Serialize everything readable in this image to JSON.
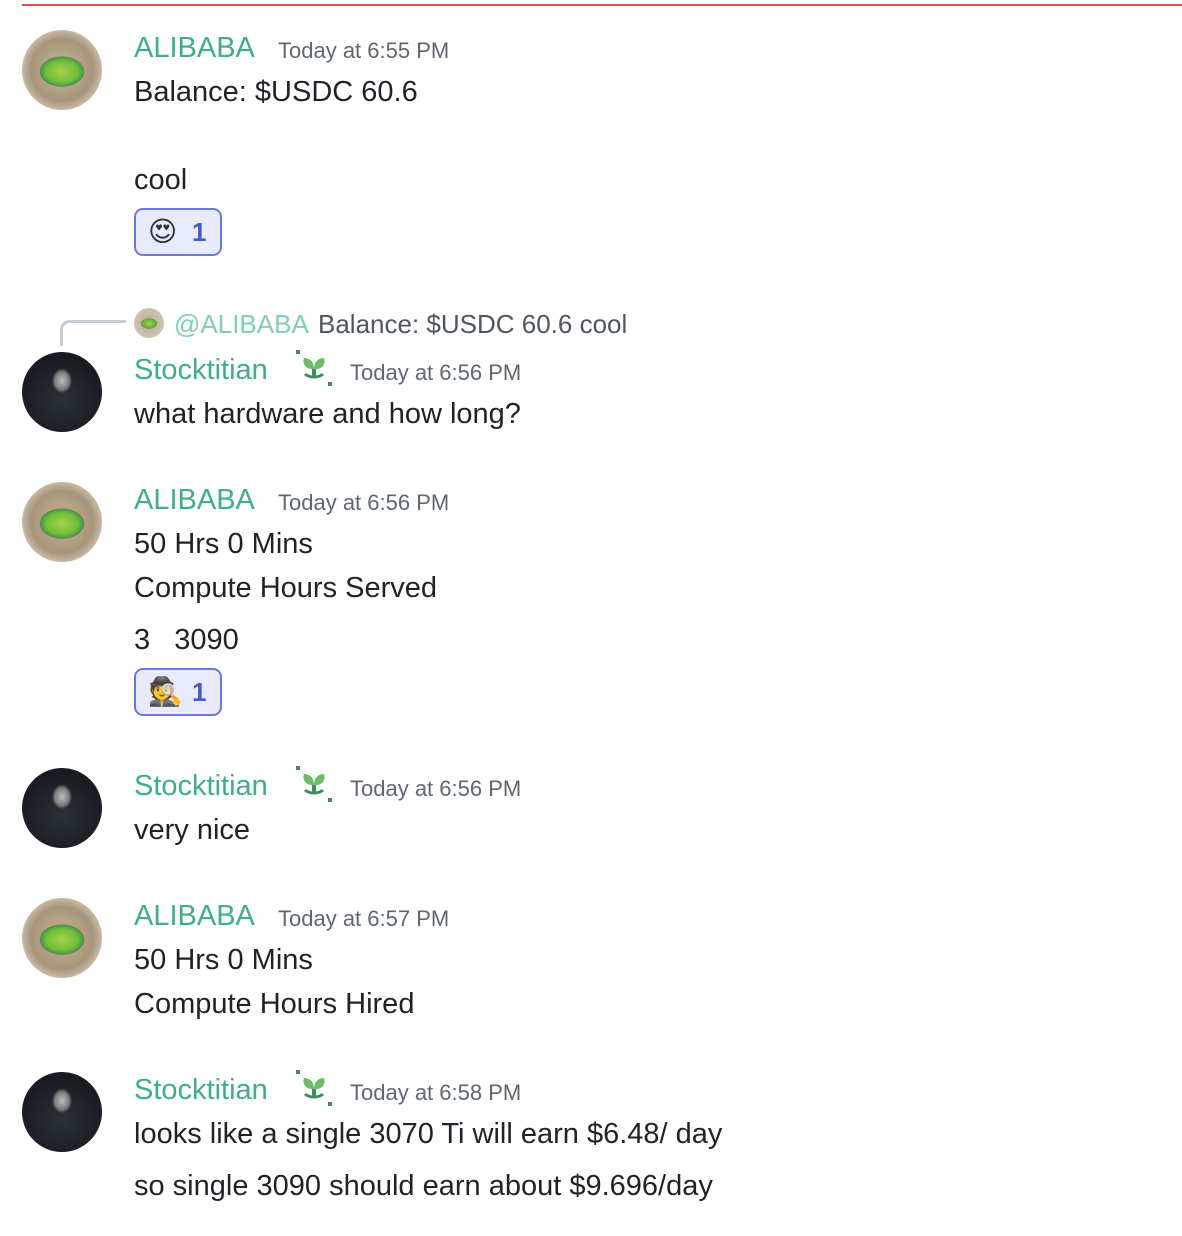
{
  "messages": [
    {
      "author": "ALIBABA",
      "timestamp": "Today at 6:55 PM",
      "lines": [
        "Balance: $USDC 60.6",
        "cool"
      ],
      "reaction": {
        "emoji": "😍",
        "count": "1"
      }
    },
    {
      "reply": {
        "mention": "@ALIBABA",
        "text": "Balance: $USDC 60.6 cool"
      },
      "author": "Stocktitian",
      "timestamp": "Today at 6:56 PM",
      "lines": [
        "what hardware and how long?"
      ]
    },
    {
      "author": "ALIBABA",
      "timestamp": "Today at 6:56 PM",
      "lines": [
        "50 Hrs 0 Mins",
        "Compute Hours Served",
        "3   3090"
      ],
      "reaction": {
        "emoji": "🕵️",
        "count": "1"
      }
    },
    {
      "author": "Stocktitian",
      "timestamp": "Today at 6:56 PM",
      "lines": [
        "very nice"
      ]
    },
    {
      "author": "ALIBABA",
      "timestamp": "Today at 6:57 PM",
      "lines": [
        "50 Hrs 0 Mins",
        "Compute Hours Hired"
      ]
    },
    {
      "author": "Stocktitian",
      "timestamp": "Today at 6:58 PM",
      "lines": [
        "looks like a single 3070 Ti will earn $6.48/ day",
        "so single 3090 should earn about $9.696/day"
      ]
    }
  ],
  "colors": {
    "username": "#3fae8b",
    "divider": "#d9534f",
    "reaction_border": "#6b77e0",
    "reaction_bg": "#e8eaff"
  },
  "icons": {
    "avatar_alibaba": "crater-avatar",
    "avatar_stocktitian": "reaper-avatar",
    "role_badge": "sprout-icon"
  }
}
